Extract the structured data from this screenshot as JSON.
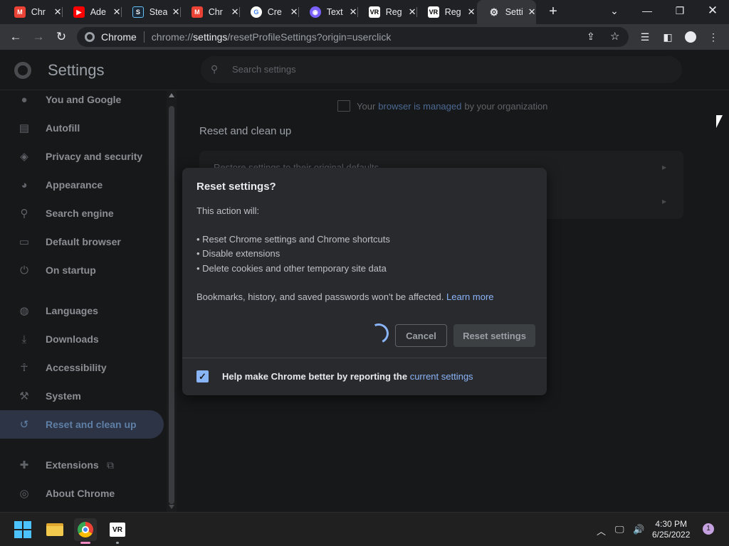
{
  "tabs": [
    {
      "title": "Chr",
      "icon": "gmail-icon",
      "color": "#ea4335"
    },
    {
      "title": "Ade",
      "icon": "youtube-icon",
      "color": "#ff0000"
    },
    {
      "title": "Stea",
      "icon": "steam-icon",
      "color": "#1b2838"
    },
    {
      "title": "Chr",
      "icon": "gmail-icon",
      "color": "#ea4335"
    },
    {
      "title": "Cre",
      "icon": "google-icon",
      "color": "#4285f4"
    },
    {
      "title": "Text",
      "icon": "chat-icon",
      "color": "#7b61ff"
    },
    {
      "title": "Reg",
      "icon": "vr-icon",
      "color": "#ffffff"
    },
    {
      "title": "Reg",
      "icon": "vr-icon",
      "color": "#ffffff"
    },
    {
      "title": "Setti",
      "icon": "gear-icon",
      "color": "#e8eaed"
    }
  ],
  "toolbar": {
    "site_label": "Chrome",
    "url_prefix": "chrome://",
    "url_strong": "settings",
    "url_rest": "/resetProfileSettings?origin=userclick"
  },
  "settings": {
    "title": "Settings",
    "search_placeholder": "Search settings"
  },
  "sidebar": {
    "items": [
      {
        "label": "You and Google",
        "icon": "person-icon"
      },
      {
        "label": "Autofill",
        "icon": "clipboard-icon"
      },
      {
        "label": "Privacy and security",
        "icon": "shield-icon"
      },
      {
        "label": "Appearance",
        "icon": "palette-icon"
      },
      {
        "label": "Search engine",
        "icon": "search-icon"
      },
      {
        "label": "Default browser",
        "icon": "browser-icon"
      },
      {
        "label": "On startup",
        "icon": "power-icon"
      },
      {
        "label": "Languages",
        "icon": "globe-icon"
      },
      {
        "label": "Downloads",
        "icon": "download-icon"
      },
      {
        "label": "Accessibility",
        "icon": "accessibility-icon"
      },
      {
        "label": "System",
        "icon": "wrench-icon"
      },
      {
        "label": "Reset and clean up",
        "icon": "history-icon"
      },
      {
        "label": "Extensions",
        "icon": "puzzle-icon"
      },
      {
        "label": "About Chrome",
        "icon": "chrome-icon"
      }
    ],
    "active": "Reset and clean up"
  },
  "main": {
    "managed_prefix": "Your",
    "managed_link": "browser is managed",
    "managed_suffix": "by your organization",
    "section_title": "Reset and clean up",
    "card_row1": "Restore settings to their original defaults"
  },
  "dialog": {
    "title": "Reset settings?",
    "intro": "This action will:",
    "bullets": [
      "• Reset Chrome settings and Chrome shortcuts",
      "• Disable extensions",
      "• Delete cookies and other temporary site data"
    ],
    "note": "Bookmarks, history, and saved passwords won't be affected.",
    "learn_more": "Learn more",
    "cancel_label": "Cancel",
    "reset_label": "Reset settings",
    "checkbox_checked": true,
    "checkbox_label": "Help make Chrome better by reporting the",
    "checkbox_link": "current settings"
  },
  "taskbar": {
    "time": "4:30 PM",
    "date": "6/25/2022",
    "notification_count": "1"
  }
}
